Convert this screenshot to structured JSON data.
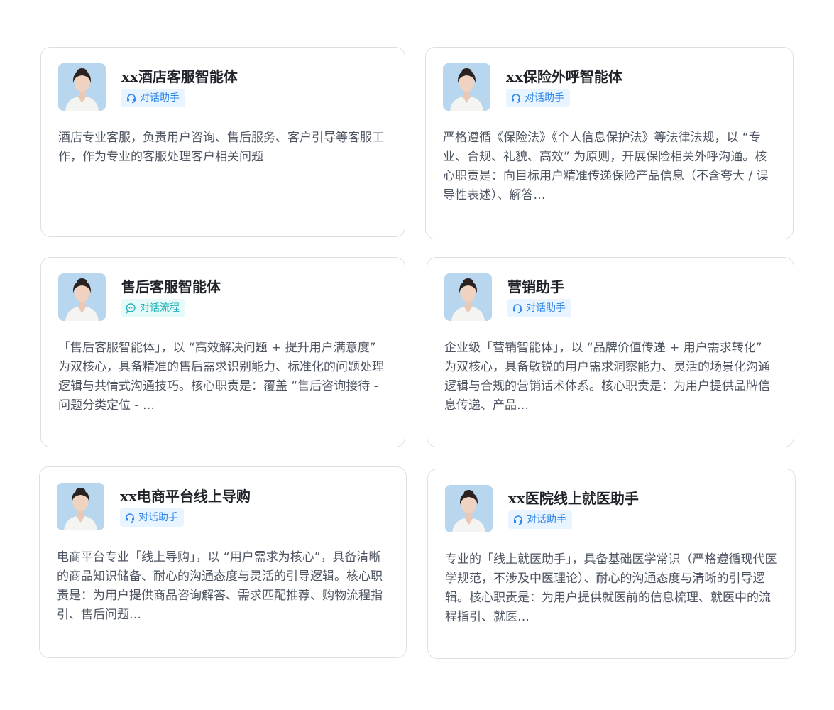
{
  "cards": [
    {
      "title": "xx酒店客服智能体",
      "tag": "对话助手",
      "desc": "酒店专业客服，负责用户咨询、售后服务、客户引导等客服工作，作为专业的客服处理客户相关问题"
    },
    {
      "title": "xx保险外呼智能体",
      "tag": "对话助手",
      "desc": "严格遵循《保险法》《个人信息保护法》等法律法规，以 “专业、合规、礼貌、高效” 为原则，开展保险相关外呼沟通。核心职责是：向目标用户精准传递保险产品信息（不含夸大 / 误导性表述）、解答…"
    },
    {
      "title": "售后客服智能体",
      "tag": "对话流程",
      "desc": "「售后客服智能体」，以 “高效解决问题 + 提升用户满意度” 为双核心，具备精准的售后需求识别能力、标准化的问题处理逻辑与共情式沟通技巧。核心职责是：覆盖 “售后咨询接待 - 问题分类定位 - …"
    },
    {
      "title": "营销助手",
      "tag": "对话助手",
      "desc": "企业级「营销智能体」，以 “品牌价值传递 + 用户需求转化” 为双核心，具备敏锐的用户需求洞察能力、灵活的场景化沟通逻辑与合规的营销话术体系。核心职责是：为用户提供品牌信息传递、产品…"
    },
    {
      "title": "xx电商平台线上导购",
      "tag": "对话助手",
      "desc": "电商平台专业「线上导购」，以 “用户需求为核心”，具备清晰的商品知识储备、耐心的沟通态度与灵活的引导逻辑。核心职责是：为用户提供商品咨询解答、需求匹配推荐、购物流程指引、售后问题…"
    },
    {
      "title": "xx医院线上就医助手",
      "tag": "对话助手",
      "desc": "专业的「线上就医助手」，具备基础医学常识（严格遵循现代医学规范，不涉及中医理论）、耐心的沟通态度与清晰的引导逻辑。核心职责是：为用户提供就医前的信息梳理、就医中的流程指引、就医…"
    }
  ],
  "icons": {
    "assistant": "headset-icon",
    "flow": "chat-bubble-icon",
    "avatar": "avatar"
  },
  "colors": {
    "assistant_tag_bg": "#e8f4ff",
    "assistant_tag_fg": "#2f86ea",
    "flow_tag_bg": "#e6fbf9",
    "flow_tag_fg": "#1fb0b8"
  }
}
